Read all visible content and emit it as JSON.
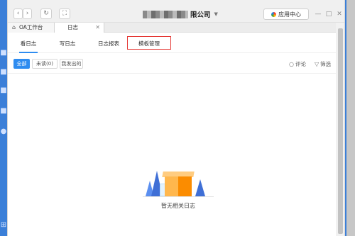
{
  "window": {
    "title_suffix": "限公司",
    "title_dropdown_icon": "caret-down-icon",
    "back_icon": "‹",
    "forward_icon": "›",
    "refresh_icon": "↻",
    "fullscreen_icon": "⛶",
    "app_center_label": "应用中心",
    "minimize_icon": "—",
    "maximize_icon": "□",
    "close_icon": "✕"
  },
  "tabs": [
    {
      "label": "OA工作台",
      "icon": "home-icon"
    },
    {
      "label": "日志",
      "close": "✕"
    }
  ],
  "subtabs": [
    {
      "label": "看日志",
      "selected": true
    },
    {
      "label": "写日志",
      "selected": false
    },
    {
      "label": "日志报表",
      "selected": false
    },
    {
      "label": "模板管理",
      "selected": false
    }
  ],
  "filters": [
    {
      "label": "全部",
      "active": true
    },
    {
      "label": "未读(0)",
      "active": false
    },
    {
      "label": "我发出的",
      "active": false
    }
  ],
  "actions": {
    "comment_icon": "comment-icon",
    "comment_label": "评论",
    "filter_icon": "filter-icon",
    "filter_label": "筛选"
  },
  "empty_state": {
    "message": "暂无相关日志"
  },
  "colors": {
    "accent": "#2e8cf0",
    "highlight": "#e53935",
    "desktop": "#3b7fd8"
  }
}
